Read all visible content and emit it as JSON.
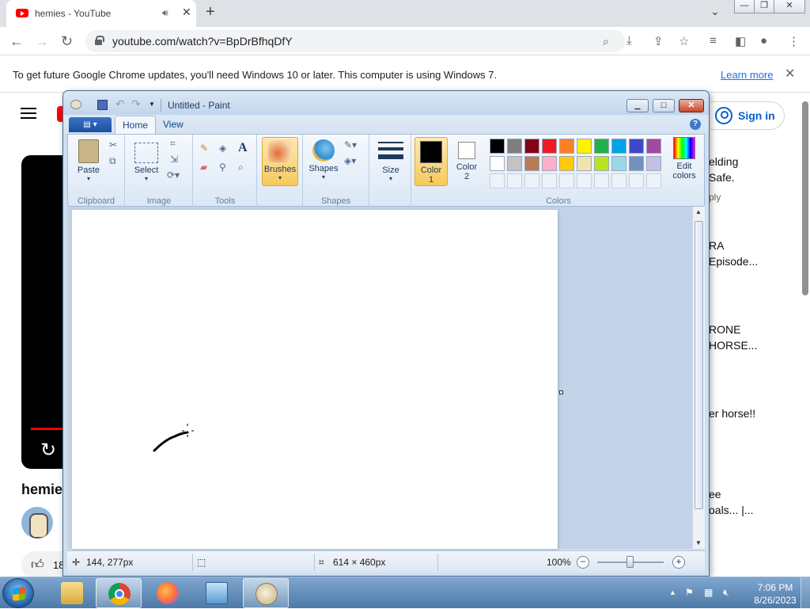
{
  "browser": {
    "tab_title": "hemies - YouTube",
    "url": "youtube.com/watch?v=BpDrBfhqDfY",
    "infobar_message": "To get future Google Chrome updates, you'll need Windows 10 or later. This computer is using Windows 7.",
    "infobar_link": "Learn more"
  },
  "youtube": {
    "sign_in": "Sign in",
    "video_title_partial": "hemie",
    "like_count_partial": "18",
    "recommendations": [
      {
        "line1": "elding",
        "line2": "Safe.",
        "meta": "ply"
      },
      {
        "line1": "RA",
        "line2": "Episode...",
        "meta": ""
      },
      {
        "line1": "RONE",
        "line2": "HORSE...",
        "meta": ""
      },
      {
        "line1": "er horse!!",
        "line2": "",
        "meta": ""
      },
      {
        "line1": "ee",
        "line2": "oals... |...",
        "meta": ""
      }
    ]
  },
  "paint": {
    "window_title": "Untitled - Paint",
    "tabs": {
      "home": "Home",
      "view": "View"
    },
    "groups": {
      "clipboard": "Clipboard",
      "image": "Image",
      "tools": "Tools",
      "shapes": "Shapes",
      "colors": "Colors"
    },
    "buttons": {
      "paste": "Paste",
      "select": "Select",
      "brushes": "Brushes",
      "shapes": "Shapes",
      "size": "Size",
      "color1_a": "Color",
      "color1_b": "1",
      "color2_a": "Color",
      "color2_b": "2",
      "edit_colors_a": "Edit",
      "edit_colors_b": "colors"
    },
    "color1": "#000000",
    "color2": "#ffffff",
    "palette_row1": [
      "#000000",
      "#7f7f7f",
      "#880015",
      "#ed1c24",
      "#ff7f27",
      "#fff200",
      "#22b14c",
      "#00a2e8",
      "#3f48cc",
      "#a349a4"
    ],
    "palette_row2": [
      "#ffffff",
      "#c3c3c3",
      "#b97a57",
      "#ffaec9",
      "#ffc90e",
      "#efe4b0",
      "#b5e61d",
      "#99d9ea",
      "#7092be",
      "#c8bfe7"
    ],
    "status": {
      "cursor_pos": "144, 277px",
      "canvas_size": "614 × 460px",
      "zoom": "100%"
    }
  },
  "taskbar": {
    "time": "7:06 PM",
    "date": "8/26/2023"
  }
}
